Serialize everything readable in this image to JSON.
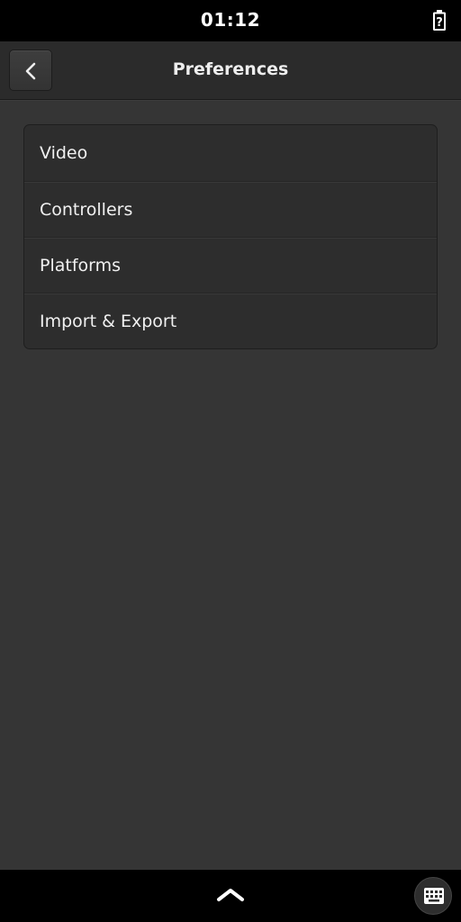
{
  "status_bar": {
    "time": "01:12",
    "battery_icon": "battery-unknown-icon",
    "battery_glyph": "?"
  },
  "header": {
    "title": "Preferences",
    "back_icon": "chevron-left-icon"
  },
  "menu": {
    "items": [
      {
        "label": "Video"
      },
      {
        "label": "Controllers"
      },
      {
        "label": "Platforms"
      },
      {
        "label": "Import & Export"
      }
    ]
  },
  "bottom_bar": {
    "up_icon": "chevron-up-icon",
    "keyboard_icon": "keyboard-icon"
  },
  "colors": {
    "background": "#353535",
    "header": "#2b2b2b",
    "list_background": "#2d2d2d",
    "bars": "#000000",
    "text": "#f0f0f0"
  }
}
